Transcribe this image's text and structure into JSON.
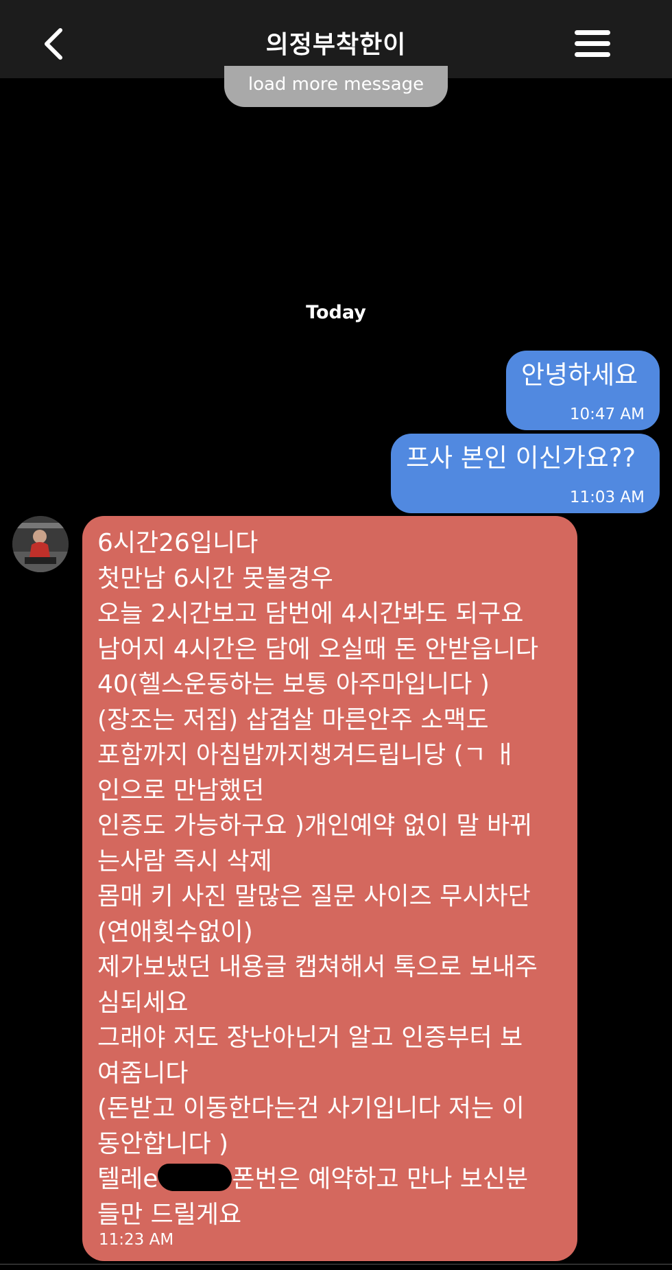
{
  "header": {
    "title": "의정부착한이",
    "back_icon": "chevron-left-icon",
    "menu_icon": "hamburger-menu-icon",
    "background": "#1c1c1c"
  },
  "load_more": {
    "label": "load more message"
  },
  "day_divider": {
    "label": "Today"
  },
  "colors": {
    "outgoing_bubble": "#5189e0",
    "incoming_bubble": "#d4685e",
    "background": "#000000"
  },
  "messages": [
    {
      "direction": "outgoing",
      "text": "안녕하세요",
      "time": "10:47 AM"
    },
    {
      "direction": "outgoing",
      "text": "프사 본인 이신가요??",
      "time": "11:03 AM"
    },
    {
      "direction": "incoming",
      "lines": [
        "6시간26입니다",
        "첫만남 6시간 못볼경우",
        "오늘 2시간보고 담번에 4시간봐도 되구요",
        "남어지 4시간은 담에 오실때 돈 안받읍니다",
        "40(헬스운동하는 보통 아주마입니다 )",
        "(장조는 저집) 삽겹살 마른안주 소맥도",
        "포함까지 아침밥까지챙겨드립니당 (ㄱ ㅐ",
        "인으로 만남했던",
        "인증도 가능하구요 )개인예약 없이 말 바뀌",
        "는사람 즉시 삭제",
        "몸매 키 사진 말많은 질문 사이즈 무시차단",
        "(연애횟수없이)",
        "제가보냈던 내용글 캡쳐해서 톡으로 보내주",
        "심되세요",
        "그래야 저도 장난아닌거 알고 인증부터 보",
        "여줌니다",
        "(돈받고 이동한다는건 사기입니다 저는 이",
        "동안합니다 )"
      ],
      "redacted_line_start": "텔레e",
      "redacted_line_end": "폰번은 예약하고 만나 보신분",
      "last_line": "들만 드릴게요",
      "time": "11:23 AM"
    }
  ]
}
